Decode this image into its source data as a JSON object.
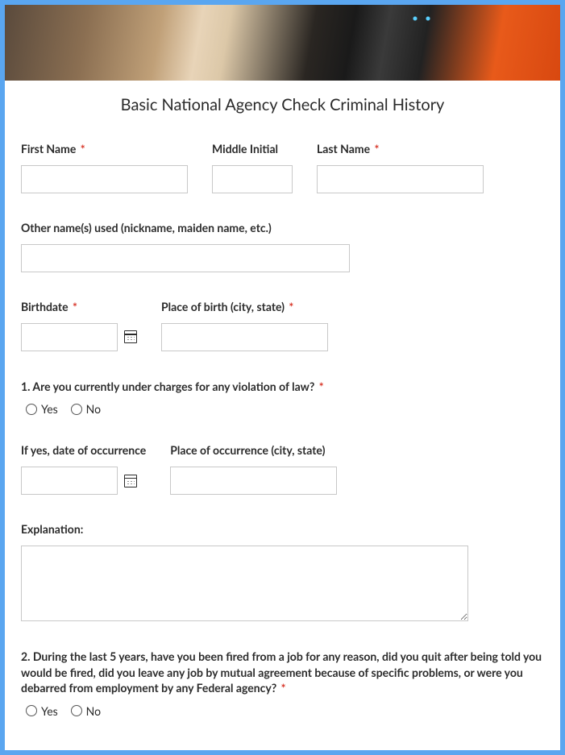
{
  "title": "Basic National Agency Check Criminal History",
  "labels": {
    "first_name": "First Name",
    "middle_initial": "Middle Initial",
    "last_name": "Last Name",
    "other_names": "Other name(s) used (nickname, maiden name, etc.)",
    "birthdate": "Birthdate",
    "place_of_birth": "Place of birth (city, state)",
    "date_of_occurrence": "If yes, date of occurrence",
    "place_of_occurrence": "Place of occurrence (city, state)",
    "explanation": "Explanation:"
  },
  "questions": {
    "q1": "1. Are you currently under charges for any violation of law?",
    "q2": "2. During the last 5 years, have you been fired from a job for any reason, did you quit after being told you would be fired, did you leave any job by mutual agreement because of specific problems, or were you debarred from employment by any Federal agency?"
  },
  "options": {
    "yes": "Yes",
    "no": "No"
  },
  "required_marker": "*",
  "values": {
    "first_name": "",
    "middle_initial": "",
    "last_name": "",
    "other_names": "",
    "birthdate": "",
    "place_of_birth": "",
    "date_of_occurrence": "",
    "place_of_occurrence": "",
    "explanation": ""
  }
}
